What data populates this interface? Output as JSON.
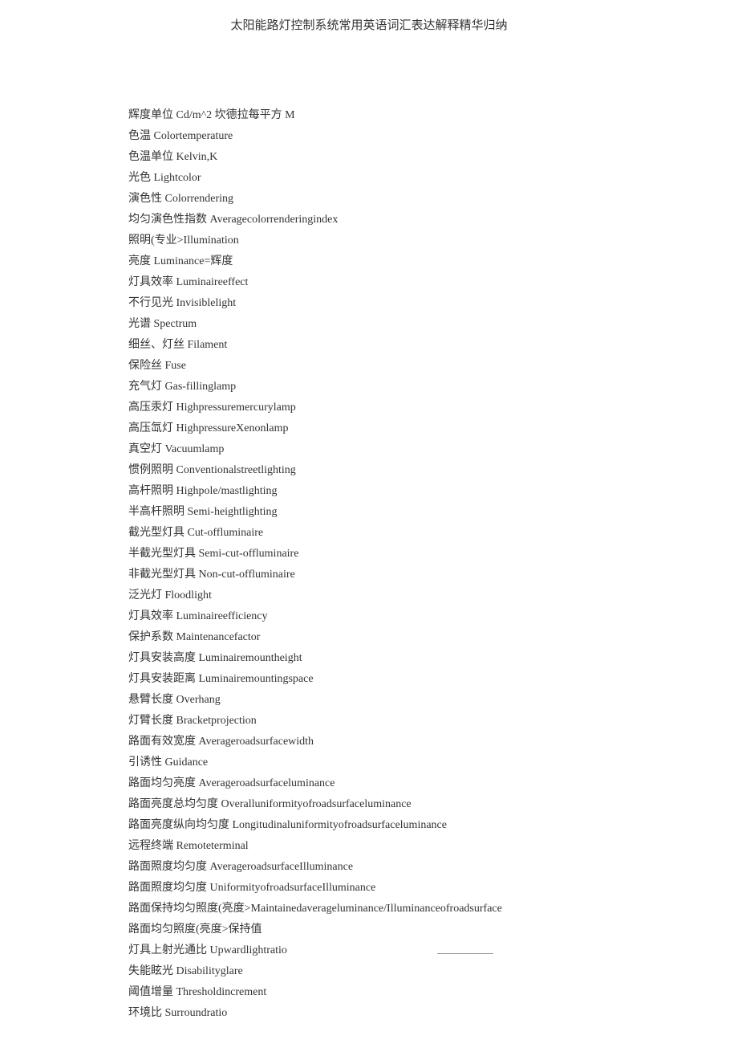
{
  "title": "太阳能路灯控制系统常用英语词汇表达解释精华归纳",
  "terms": [
    "辉度单位 Cd/m^2 坎德拉每平方 M",
    "色温 Colortemperature",
    "色温单位 Kelvin,K",
    "光色 Lightcolor",
    "演色性 Colorrendering",
    "均匀演色性指数 Averagecolorrenderingindex",
    "照明(专业>Illumination",
    "亮度 Luminance=辉度",
    "灯具效率 Luminaireeffect",
    "不行见光 Invisiblelight",
    "光谱 Spectrum",
    "细丝、灯丝 Filament",
    "保险丝 Fuse",
    "充气灯 Gas-fillinglamp",
    "高压汞灯 Highpressuremercurylamp",
    "高压氙灯 HighpressureXenonlamp",
    "真空灯 Vacuumlamp",
    "惯例照明 Conventionalstreetlighting",
    "高杆照明 Highpole/mastlighting",
    "半高杆照明 Semi-heightlighting",
    "截光型灯具 Cut-offluminaire",
    "半截光型灯具 Semi-cut-offluminaire",
    "非截光型灯具 Non-cut-offluminaire",
    "泛光灯 Floodlight",
    "灯具效率 Luminaireefficiency",
    "保护系数 Maintenancefactor",
    "灯具安装高度 Luminairemountheight",
    "灯具安装距离 Luminairemountingspace",
    "悬臂长度 Overhang",
    "灯臂长度 Bracketprojection",
    "路面有效宽度 Averageroadsurfacewidth",
    "引诱性 Guidance",
    "路面均匀亮度 Averageroadsurfaceluminance",
    "路面亮度总均匀度 Overalluniformityofroadsurfaceluminance",
    "路面亮度纵向均匀度 Longitudinaluniformityofroadsurfaceluminance",
    "远程终端 Remoteterminal",
    "路面照度均匀度 AverageroadsurfaceIlluminance",
    "路面照度均匀度 UniformityofroadsurfaceIlluminance",
    "路面保持均匀照度(亮度>Maintainedaverageluminance/Illuminanceofroadsurface",
    "路面均匀照度(亮度>保持值",
    "灯具上射光通比 Upwardlightratio",
    "失能眩光 Disabilityglare",
    "阈值增量 Thresholdincrement",
    "环境比 Surroundratio"
  ],
  "underline_after_index": 40
}
